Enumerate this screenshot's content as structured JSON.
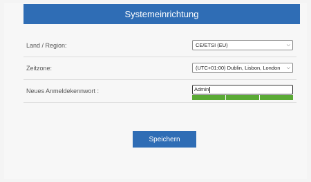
{
  "header": {
    "title": "Systemeinrichtung"
  },
  "form": {
    "region": {
      "label": "Land / Region:",
      "value": "CE/ETSI (EU)"
    },
    "timezone": {
      "label": "Zeitzone:",
      "value": "(UTC+01:00) Dublin, Lisbon, London"
    },
    "password": {
      "label": "Neues Anmeldekennwort :",
      "value": "Admin",
      "strength": 1.0
    }
  },
  "save_button": {
    "label": "Speichern"
  },
  "colors": {
    "primary": "#2f6db5",
    "strength_bar": "#5aaa35"
  }
}
